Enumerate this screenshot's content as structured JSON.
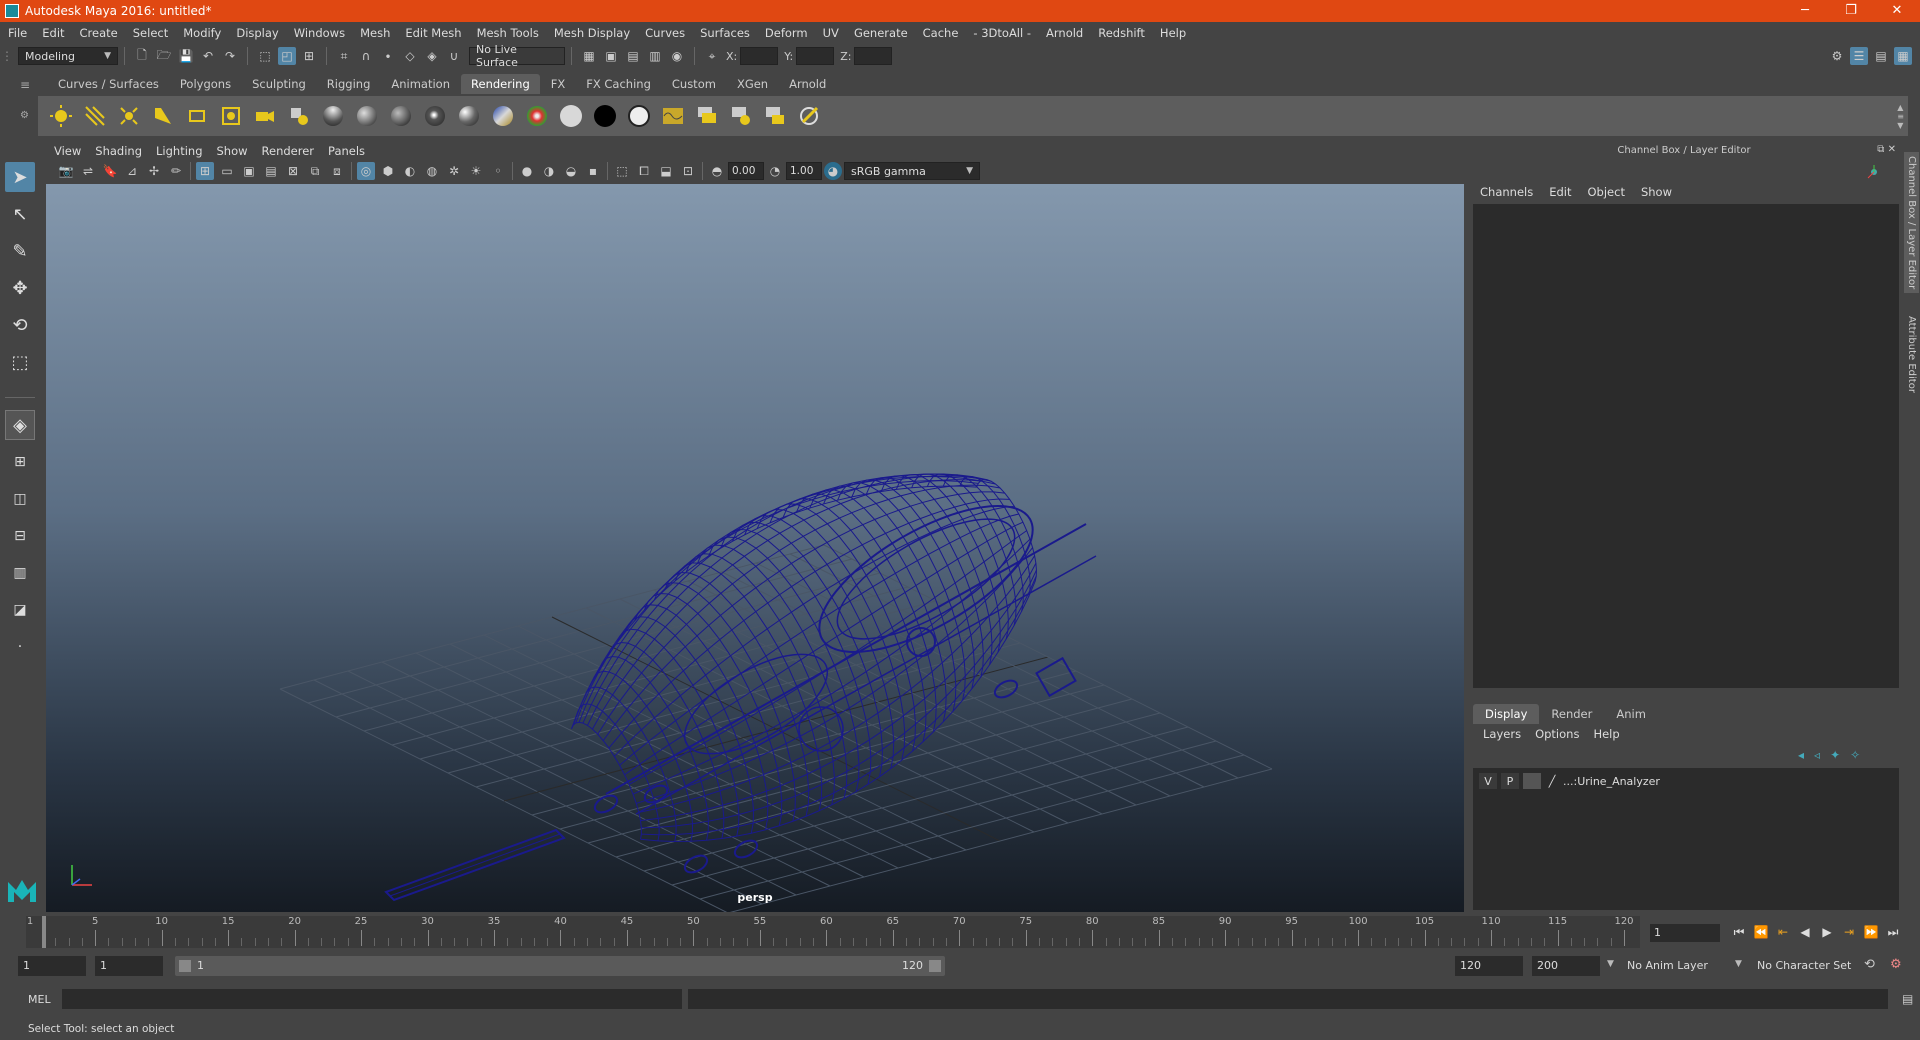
{
  "window": {
    "title": "Autodesk Maya 2016: untitled*",
    "min": "─",
    "max": "❐",
    "close": "✕"
  },
  "menubar": [
    "File",
    "Edit",
    "Create",
    "Select",
    "Modify",
    "Display",
    "Windows",
    "Mesh",
    "Edit Mesh",
    "Mesh Tools",
    "Mesh Display",
    "Curves",
    "Surfaces",
    "Deform",
    "UV",
    "Generate",
    "Cache",
    "- 3DtoAll -",
    "Arnold",
    "Redshift",
    "Help"
  ],
  "statusline": {
    "menuset": "Modeling",
    "live_surface": "No Live Surface",
    "x_label": "X:",
    "y_label": "Y:",
    "z_label": "Z:"
  },
  "shelf": {
    "tabs": [
      "Curves / Surfaces",
      "Polygons",
      "Sculpting",
      "Rigging",
      "Animation",
      "Rendering",
      "FX",
      "FX Caching",
      "Custom",
      "XGen",
      "Arnold"
    ],
    "active_tab": "Rendering"
  },
  "viewport": {
    "menu": [
      "View",
      "Shading",
      "Lighting",
      "Show",
      "Renderer",
      "Panels"
    ],
    "exposure": "0.00",
    "gamma": "1.00",
    "color_space": "sRGB gamma",
    "camera": "persp",
    "wire_color": "#1a1a8c"
  },
  "channelbox": {
    "title": "Channel Box / Layer Editor",
    "menu": [
      "Channels",
      "Edit",
      "Object",
      "Show"
    ]
  },
  "layers": {
    "tabs": [
      "Display",
      "Render",
      "Anim"
    ],
    "active_tab": "Display",
    "menu": [
      "Layers",
      "Options",
      "Help"
    ],
    "row": {
      "v": "V",
      "p": "P",
      "name": "...:Urine_Analyzer"
    }
  },
  "side_tabs": [
    "Channel Box / Layer Editor",
    "Attribute Editor"
  ],
  "timeline": {
    "labels": [
      5,
      10,
      15,
      20,
      25,
      30,
      35,
      40,
      45,
      50,
      55,
      60,
      65,
      70,
      75,
      80,
      85,
      90,
      95,
      100,
      105,
      110,
      115,
      120
    ],
    "start_label": "1",
    "current_frame": "1",
    "min": 1,
    "max": 120
  },
  "range": {
    "start": "1",
    "anim_start": "1",
    "slider_start": "1",
    "slider_end": "120",
    "end": "120",
    "anim_end": "200",
    "anim_layer": "No Anim Layer",
    "char_set": "No Character Set"
  },
  "cmdline": {
    "label": "MEL"
  },
  "helpline": {
    "text": "Select Tool: select an object"
  }
}
